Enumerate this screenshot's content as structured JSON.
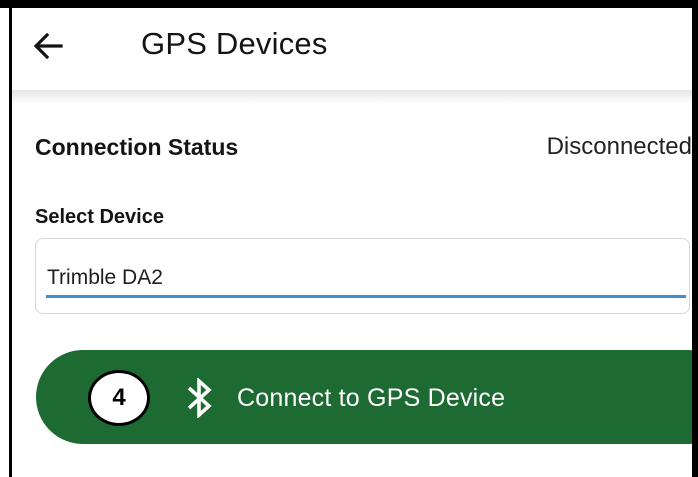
{
  "header": {
    "back_icon": "arrow-left-icon",
    "title": "GPS Devices"
  },
  "connection": {
    "label": "Connection Status",
    "value": "Disconnected"
  },
  "device_select": {
    "label": "Select Device",
    "selected_value": "Trimble DA2"
  },
  "connect_button": {
    "step_number": "4",
    "icon": "bluetooth-icon",
    "label": "Connect to GPS Device"
  },
  "colors": {
    "button_green": "#1d6a32",
    "select_underline_blue": "#3d8fd6"
  }
}
